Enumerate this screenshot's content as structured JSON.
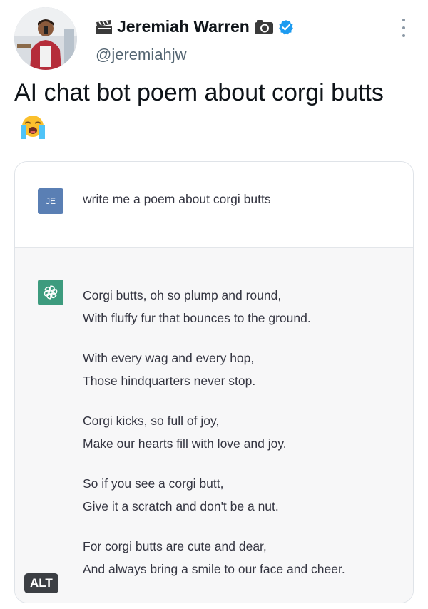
{
  "tweet": {
    "author": {
      "display_name": "Jeremiah Warren",
      "handle": "@jeremiahjw",
      "name_prefix_icon": "clapper-board-icon",
      "name_suffix_icon": "camera-icon",
      "verified": true
    },
    "text": "AI chat bot poem about corgi butts",
    "emoji": "loudly-crying-face-emoji",
    "more_icon": "more-vertical-icon"
  },
  "chat": {
    "user_avatar_label": "JE",
    "user_message": "write me a poem about corgi butts",
    "bot_icon": "openai-logo-icon",
    "poem": [
      [
        "Corgi butts, oh so plump and round,",
        "With fluffy fur that bounces to the ground."
      ],
      [
        "With every wag and every hop,",
        "Those hindquarters never stop."
      ],
      [
        "Corgi kicks, so full of joy,",
        "Make our hearts fill with love and joy."
      ],
      [
        "So if you see a corgi butt,",
        "Give it a scratch and don't be a nut."
      ],
      [
        "For corgi butts are cute and dear,",
        "And always bring a smile to our face and cheer."
      ]
    ]
  },
  "alt_badge": "ALT",
  "colors": {
    "user_badge": "#5a7fb4",
    "bot_badge": "#3d9b7e",
    "verified": "#1d9bf0",
    "handle": "#536471"
  }
}
